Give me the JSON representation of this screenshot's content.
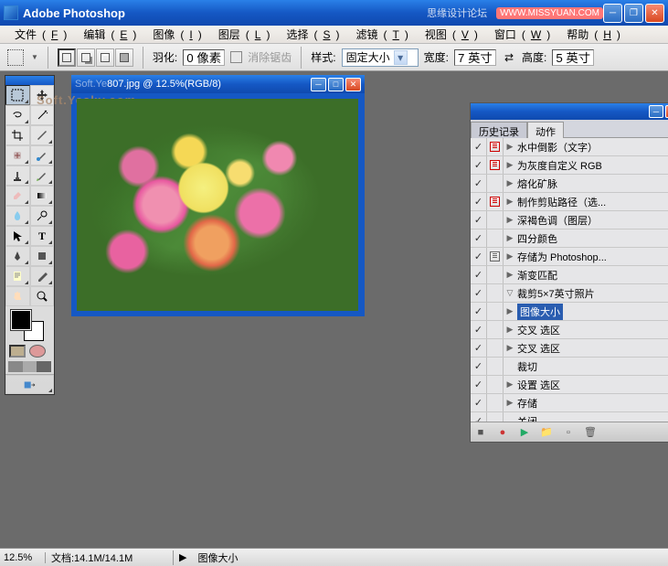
{
  "app": {
    "title": "Adobe Photoshop",
    "watermark_text": "思缘设计论坛",
    "watermark_badge": "WWW.MISSYUAN.COM"
  },
  "menu": {
    "file": "文件",
    "file_k": "F",
    "edit": "编辑",
    "edit_k": "E",
    "image": "图像",
    "image_k": "I",
    "layer": "图层",
    "layer_k": "L",
    "select": "选择",
    "select_k": "S",
    "filter": "滤镜",
    "filter_k": "T",
    "view": "视图",
    "view_k": "V",
    "window": "窗口",
    "window_k": "W",
    "help": "帮助",
    "help_k": "H"
  },
  "options": {
    "feather_label": "羽化:",
    "feather_value": "0 像素",
    "antialias": "消除锯齿",
    "style_label": "样式:",
    "style_value": "固定大小",
    "width_label": "宽度:",
    "width_value": "7 英寸",
    "height_label": "高度:",
    "height_value": "5 英寸"
  },
  "doc": {
    "title_prefix": "Soft.Ye",
    "title": "807.jpg @ 12.5%(RGB/8)",
    "wm": "Soft.Yesky.com"
  },
  "panel": {
    "tab_history": "历史记录",
    "tab_actions": "动作",
    "items": [
      {
        "chk": true,
        "dlg": "red",
        "indent": 1,
        "tw": "▶",
        "label": "水中倒影（文字）"
      },
      {
        "chk": true,
        "dlg": "red",
        "indent": 1,
        "tw": "▶",
        "label": "为灰度自定义 RGB"
      },
      {
        "chk": true,
        "dlg": "",
        "indent": 1,
        "tw": "▶",
        "label": "熔化矿脉"
      },
      {
        "chk": true,
        "dlg": "red",
        "indent": 1,
        "tw": "▶",
        "label": "制作剪贴路径（选..."
      },
      {
        "chk": true,
        "dlg": "",
        "indent": 1,
        "tw": "▶",
        "label": "深褐色调（图层）"
      },
      {
        "chk": true,
        "dlg": "",
        "indent": 1,
        "tw": "▶",
        "label": "四分颜色"
      },
      {
        "chk": true,
        "dlg": "gray",
        "indent": 1,
        "tw": "▶",
        "label": "存储为 Photoshop..."
      },
      {
        "chk": true,
        "dlg": "",
        "indent": 1,
        "tw": "▶",
        "label": "渐变匹配"
      },
      {
        "chk": true,
        "dlg": "",
        "indent": 1,
        "tw": "▽",
        "label": "裁剪5×7英寸照片"
      },
      {
        "chk": true,
        "dlg": "",
        "indent": 2,
        "tw": "▶",
        "label": "图像大小",
        "sel": true
      },
      {
        "chk": true,
        "dlg": "",
        "indent": 2,
        "tw": "▶",
        "label": "交叉 选区"
      },
      {
        "chk": true,
        "dlg": "",
        "indent": 2,
        "tw": "▶",
        "label": "交叉 选区"
      },
      {
        "chk": true,
        "dlg": "",
        "indent": 2,
        "tw": "",
        "label": "裁切"
      },
      {
        "chk": true,
        "dlg": "",
        "indent": 2,
        "tw": "▶",
        "label": "设置 选区"
      },
      {
        "chk": true,
        "dlg": "",
        "indent": 2,
        "tw": "▶",
        "label": "存储"
      },
      {
        "chk": true,
        "dlg": "",
        "indent": 2,
        "tw": "",
        "label": "关闭"
      }
    ]
  },
  "status": {
    "zoom": "12.5%",
    "doc": "文档:14.1M/14.1M",
    "info": "图像大小"
  }
}
